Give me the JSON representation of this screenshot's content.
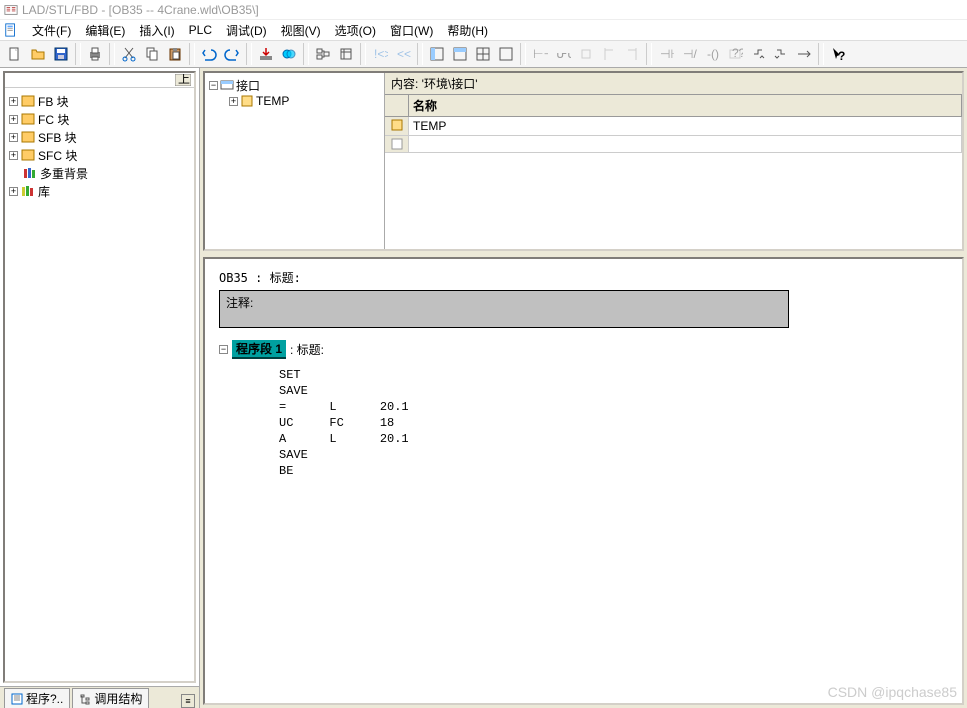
{
  "title": "LAD/STL/FBD  - [OB35 -- 4Crane.wld\\OB35\\]",
  "menu": [
    "文件(F)",
    "编辑(E)",
    "插入(I)",
    "PLC",
    "调试(D)",
    "视图(V)",
    "选项(O)",
    "窗口(W)",
    "帮助(H)"
  ],
  "sidebar": {
    "items": [
      {
        "label": "FB 块",
        "icon": "block"
      },
      {
        "label": "FC 块",
        "icon": "block"
      },
      {
        "label": "SFB 块",
        "icon": "block"
      },
      {
        "label": "SFC 块",
        "icon": "block"
      },
      {
        "label": "多重背景",
        "icon": "books"
      },
      {
        "label": "库",
        "icon": "books"
      }
    ]
  },
  "tabs": {
    "t1": "程序?..",
    "t2": "调用结构"
  },
  "upper": {
    "left_root": "接口",
    "left_child": "TEMP",
    "right_header": "内容:    '环境\\接口'",
    "col_name": "名称",
    "row_temp": "TEMP"
  },
  "code": {
    "ob_line": "OB35 : 标题:",
    "comment_label": "注释:",
    "seg_label": "程序段 1",
    "seg_suffix": ": 标题:",
    "lines": "SET\nSAVE\n=      L      20.1\nUC     FC     18\nA      L      20.1\nSAVE\nBE"
  },
  "watermark": "CSDN @ipqchase85",
  "icons": {
    "new": "new",
    "open": "open",
    "save": "save",
    "print": "print",
    "cut": "cut",
    "copy": "copy",
    "paste": "paste",
    "undo": "undo",
    "redo": "redo",
    "download": "dl",
    "monitor": "mon",
    "db": "db",
    "symbol": "sym",
    "find": "find",
    "goto": "goto",
    "help": "help"
  }
}
